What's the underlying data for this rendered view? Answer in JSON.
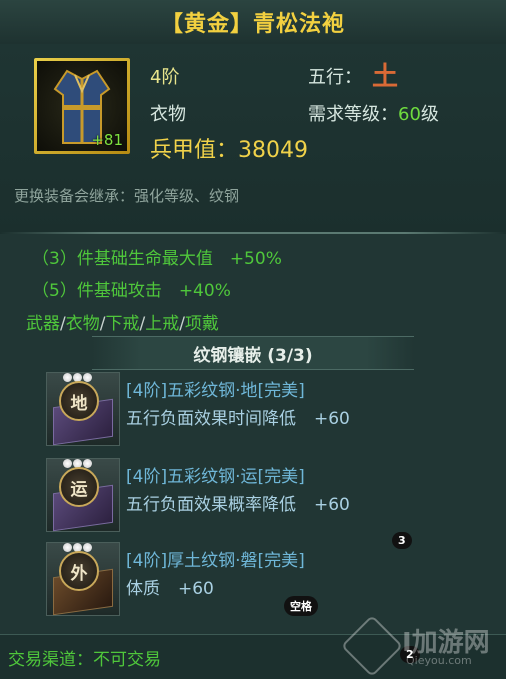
{
  "item": {
    "title": "【黄金】青松法袍",
    "grade": "4阶",
    "type": "衣物",
    "power_label": "兵甲值：",
    "power_value": "38049",
    "element_label": "五行：",
    "element_value": "土",
    "req_label": "需求等级：",
    "req_level": "60",
    "req_unit": "级",
    "enhance": "+81",
    "inherit_note": "更换装备会继承：强化等级、纹钢"
  },
  "set_bonus": {
    "lines": [
      "（3）件基础生命最大值　+50%",
      "（5）件基础攻击　+40%"
    ],
    "parts": [
      "武器",
      "衣物",
      "下戒",
      "上戒",
      "项戴"
    ]
  },
  "section": {
    "title": "纹钢镶嵌 (3/3)"
  },
  "gems": [
    {
      "badge": "地",
      "name": "[4阶]五彩纹钢·地[完美]",
      "effect": "五行负面效果时间降低",
      "value": "+60"
    },
    {
      "badge": "运",
      "name": "[4阶]五彩纹钢·运[完美]",
      "effect": "五行负面效果概率降低",
      "value": "+60"
    },
    {
      "badge": "外",
      "name": "[4阶]厚土纹钢·磐[完美]",
      "effect": "体质",
      "value": "+60"
    }
  ],
  "badges": {
    "num3": "3",
    "space": "空格",
    "num2": "2"
  },
  "trade": {
    "text": "交易渠道：不可交易"
  },
  "watermark": {
    "main": "I加游网",
    "sub": "Qieyou.com"
  }
}
